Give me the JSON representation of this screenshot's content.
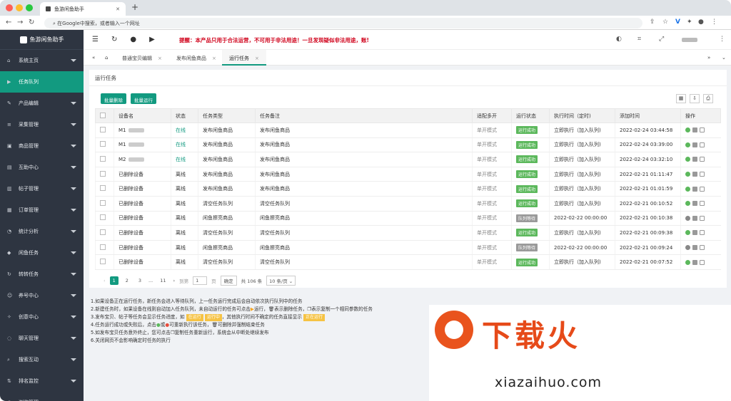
{
  "browser": {
    "tab_title": "鱼游闲鱼助手",
    "address_placeholder": "在Google中搜索，或者输入一个网址",
    "colors": {
      "close": "#ff5f57",
      "min": "#febc2e",
      "max": "#28c840"
    }
  },
  "sidebar": {
    "logo_text": "鱼游闲鱼助手",
    "items": [
      {
        "label": "系统主页",
        "icon": "home-icon"
      },
      {
        "label": "任务队列",
        "icon": "play-icon"
      },
      {
        "label": "产品编辑",
        "icon": "edit-icon"
      },
      {
        "label": "采集管理",
        "icon": "list-icon"
      },
      {
        "label": "商品管理",
        "icon": "box-icon"
      },
      {
        "label": "互助中心",
        "icon": "briefcase-icon"
      },
      {
        "label": "帖子管理",
        "icon": "note-icon"
      },
      {
        "label": "订单管理",
        "icon": "order-icon"
      },
      {
        "label": "统计分析",
        "icon": "chart-icon"
      },
      {
        "label": "闲鱼任务",
        "icon": "fish-icon"
      },
      {
        "label": "转转任务",
        "icon": "refresh-icon"
      },
      {
        "label": "养号中心",
        "icon": "user-icon"
      },
      {
        "label": "创意中心",
        "icon": "idea-icon"
      },
      {
        "label": "聊天管理",
        "icon": "chat-icon"
      },
      {
        "label": "搜索互动",
        "icon": "search-icon"
      },
      {
        "label": "排名监控",
        "icon": "rank-icon"
      },
      {
        "label": "浏览管理",
        "icon": "eye-icon"
      }
    ]
  },
  "header": {
    "warning": "提醒：本产品只用于合法运营，不可用于非法用途！一旦发现疑似非法用途，账!"
  },
  "pagetabs": [
    {
      "label": "普通宝贝编辑"
    },
    {
      "label": "发布闲鱼商品"
    },
    {
      "label": "运行任务"
    }
  ],
  "panel": {
    "title": "运行任务",
    "btn_batch_delete": "批量删除",
    "btn_batch_run": "批量运行",
    "columns": [
      "设备名",
      "状态",
      "任务类型",
      "任务备注",
      "适配多开",
      "运行状态",
      "执行时间（定时)",
      "添加时间",
      "操作"
    ],
    "rows": [
      {
        "device": "M1",
        "status": "在线",
        "type": "发布闲鱼商品",
        "note": "发布闲鱼商品",
        "mode": "单开模式",
        "run": "运行成功",
        "exec": "立即执行（加入队列)",
        "added": "2022-02-24 03:44:58"
      },
      {
        "device": "M1",
        "status": "在线",
        "type": "发布闲鱼商品",
        "note": "发布闲鱼商品",
        "mode": "单开模式",
        "run": "运行成功",
        "exec": "立即执行（加入队列)",
        "added": "2022-02-24 03:39:00"
      },
      {
        "device": "M2",
        "status": "在线",
        "type": "发布闲鱼商品",
        "note": "发布闲鱼商品",
        "mode": "单开模式",
        "run": "运行成功",
        "exec": "立即执行（加入队列)",
        "added": "2022-02-24 03:32:10"
      },
      {
        "device": "已删除设备",
        "status": "离线",
        "type": "发布闲鱼商品",
        "note": "发布闲鱼商品",
        "mode": "单开模式",
        "run": "运行成功",
        "exec": "立即执行（加入队列)",
        "added": "2022-02-21 01:11:47"
      },
      {
        "device": "已删除设备",
        "status": "离线",
        "type": "发布闲鱼商品",
        "note": "发布闲鱼商品",
        "mode": "单开模式",
        "run": "运行成功",
        "exec": "立即执行（加入队列)",
        "added": "2022-02-21 01:01:59"
      },
      {
        "device": "已删除设备",
        "status": "离线",
        "type": "清空任务队列",
        "note": "清空任务队列",
        "mode": "单开模式",
        "run": "运行成功",
        "exec": "立即执行（加入队列)",
        "added": "2022-02-21 00:10:52"
      },
      {
        "device": "已删除设备",
        "status": "离线",
        "type": "闲鱼擦亮商品",
        "note": "闲鱼擦亮商品",
        "mode": "单开模式",
        "run": "队列等待",
        "exec": "2022-02-22 00:00:00",
        "added": "2022-02-21 00:10:38"
      },
      {
        "device": "已删除设备",
        "status": "离线",
        "type": "清空任务队列",
        "note": "清空任务队列",
        "mode": "单开模式",
        "run": "运行成功",
        "exec": "立即执行（加入队列)",
        "added": "2022-02-21 00:09:38"
      },
      {
        "device": "已删除设备",
        "status": "离线",
        "type": "闲鱼擦亮商品",
        "note": "闲鱼擦亮商品",
        "mode": "单开模式",
        "run": "队列等待",
        "exec": "2022-02-22 00:00:00",
        "added": "2022-02-21 00:09:24"
      },
      {
        "device": "已删除设备",
        "status": "离线",
        "type": "清空任务队列",
        "note": "清空任务队列",
        "mode": "单开模式",
        "run": "运行成功",
        "exec": "立即执行（加入队列)",
        "added": "2022-02-21 00:07:52"
      }
    ]
  },
  "pager": {
    "pages": [
      "1",
      "2",
      "3",
      "...",
      "11"
    ],
    "goto": "到第",
    "page_value": "1",
    "page_unit": "页",
    "confirm": "确定",
    "total": "共 106 条",
    "per_page": "10 条/页"
  },
  "notes": [
    "1.如果设备正在运行任务，新任务会进入等待队列，上一任务运行完成后会自动依次执行队列中的任务",
    "2.新建任务时，如果设备在线则自动加入任务队列，未自动运行的任务可点击",
    "运行，",
    "表示删除任务，",
    "表示复制一个相同参数的任务",
    "3.发布宝贝、帖子等任务会显示任务进度，如",
    "在运行",
    "运行中",
    "，其他执行时间不确定的任务直接显示",
    "正在运行",
    "4.任务运行成功或失败后，点击",
    "或",
    "可重新执行该任务，",
    "可删除并强制结束任务",
    "5.如发布宝贝任务意外终止，您可点击",
    "复制任务重新运行，系统会从中断处继续发布",
    "6.关闭网页不会影响确定时任务的执行"
  ],
  "watermark": {
    "text": "下载火",
    "url": "xiazaihuo.com"
  }
}
